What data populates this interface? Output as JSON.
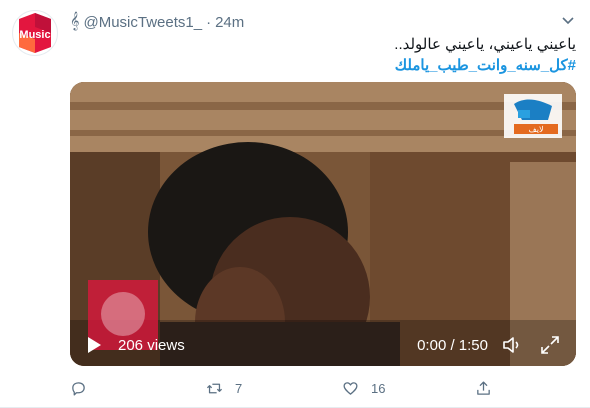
{
  "tweet": {
    "avatar_text": "Music",
    "handle": "@MusicTweets1_",
    "separator": "·",
    "time": "24m",
    "text_line1": "ياعيني ياعيني، ياعيني عالولد..",
    "hashtag": "#كل_سنه_وانت_طيب_ياملك"
  },
  "video": {
    "views": "206 views",
    "time": "0:00 / 1:50",
    "channel_logo_text": "لايف"
  },
  "actions": {
    "reply_count": "",
    "retweet_count": "7",
    "like_count": "16"
  },
  "colors": {
    "accent": "#1b95e0",
    "brand_red": "#e3163f",
    "muted": "#5b7083"
  }
}
